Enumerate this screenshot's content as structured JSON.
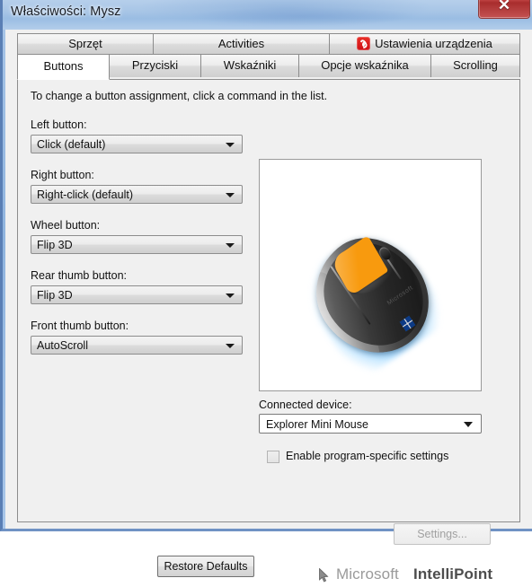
{
  "window": {
    "title": "Właściwości: Mysz",
    "close_label": "✕"
  },
  "tabs_row1": [
    {
      "label": "Sprzęt",
      "active": false,
      "icon": ""
    },
    {
      "label": "Activities",
      "active": false,
      "icon": ""
    },
    {
      "label": "Ustawienia urządzenia",
      "active": false,
      "icon": "synaptics-icon"
    }
  ],
  "tabs_row2": [
    {
      "label": "Buttons",
      "active": true
    },
    {
      "label": "Przyciski",
      "active": false
    },
    {
      "label": "Wskaźniki",
      "active": false
    },
    {
      "label": "Opcje wskaźnika",
      "active": false
    },
    {
      "label": "Scrolling",
      "active": false
    }
  ],
  "main": {
    "intro": "To change a button assignment, click a command in the list.",
    "assignments": [
      {
        "label": "Left button:",
        "value": "Click (default)"
      },
      {
        "label": "Right button:",
        "value": "Right-click (default)"
      },
      {
        "label": "Wheel button:",
        "value": "Flip 3D"
      },
      {
        "label": "Rear thumb button:",
        "value": "Flip 3D"
      },
      {
        "label": "Front thumb button:",
        "value": "AutoScroll"
      }
    ],
    "device_image_alt": "Explorer Mini Mouse illustration with left button highlighted",
    "device_label": "Connected device:",
    "device_value": "Explorer Mini Mouse",
    "enable_program_specific": "Enable program-specific settings",
    "enable_program_specific_checked": false,
    "settings_button": "Settings...",
    "settings_button_enabled": false,
    "restore_defaults_button": "Restore Defaults",
    "brand_first": "Microsoft",
    "brand_second": "IntelliPoint"
  },
  "colors": {
    "titlebar_blue": "#a7c5e6",
    "close_red": "#c04444",
    "panel_grey": "#f0f0f0",
    "accent_orange": "#f89a0e",
    "glow_blue": "#0090ff",
    "synaptics_red": "#d6121a"
  }
}
